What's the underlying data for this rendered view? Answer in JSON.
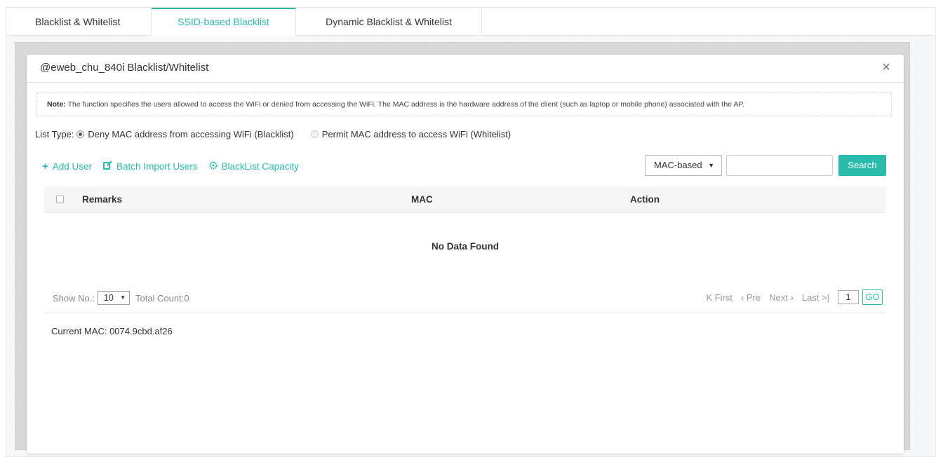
{
  "tabs": [
    {
      "label": "Blacklist & Whitelist",
      "active": false
    },
    {
      "label": "SSID-based Blacklist",
      "active": true
    },
    {
      "label": "Dynamic Blacklist & Whitelist",
      "active": false
    }
  ],
  "modal": {
    "title": "@eweb_chu_840i Blacklist/Whitelist",
    "close_icon": "×"
  },
  "note": {
    "prefix": "Note:",
    "text": "The function specifies the users allowed to access the WiFi or denied from accessing the WiFi. The MAC address is the hardware address of the client (such as laptop or mobile phone) associated with the AP."
  },
  "list_type": {
    "label": "List Type:",
    "options": [
      {
        "label": "Deny MAC address from accessing WiFi (Blacklist)",
        "checked": true
      },
      {
        "label": "Permit MAC address to access WiFi (Whitelist)",
        "checked": false
      }
    ]
  },
  "actions": {
    "add_user": "Add User",
    "batch_import": "Batch Import Users",
    "capacity": "BlackList Capacity"
  },
  "search": {
    "mode": "MAC-based",
    "value": "",
    "button": "Search"
  },
  "table": {
    "columns": [
      "Remarks",
      "MAC",
      "Action"
    ],
    "rows": [],
    "empty_message": "No Data Found"
  },
  "pagination": {
    "show_label": "Show No.:",
    "page_size": "10",
    "total": "Total Count:0",
    "first": "First",
    "prev": "Pre",
    "next": "Next",
    "last": "Last",
    "current_page": "1",
    "go": "GO"
  },
  "current_mac": "Current MAC: 0074.9cbd.af26",
  "colors": {
    "accent": "#2bbbad",
    "overlay": "#d9d9d9"
  }
}
